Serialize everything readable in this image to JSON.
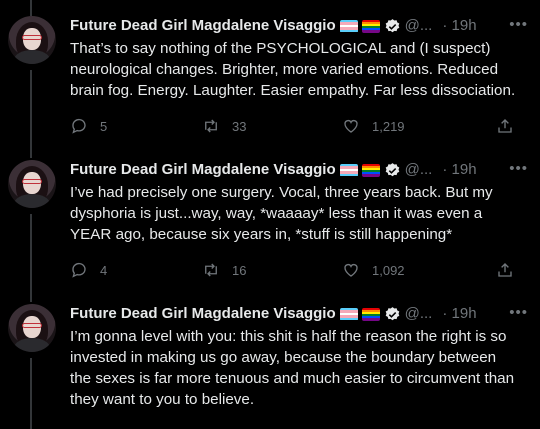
{
  "tweets": [
    {
      "name": "Future Dead Girl Magdalene Visaggio",
      "handle": "@...",
      "time": "· 19h",
      "lines": [
        "That’s to say nothing of the PSYCHOLOGICAL and (I suspect)",
        "neurological changes. Brighter, more varied emotions. Reduced",
        "brain fog. Energy. Laughter. Easier empathy. Far less dissociation."
      ],
      "replies": "5",
      "retweets": "33",
      "likes": "1,219"
    },
    {
      "name": "Future Dead Girl Magdalene Visaggio",
      "handle": "@...",
      "time": "· 19h",
      "lines": [
        "I’ve had precisely one surgery. Vocal, three years back. But my",
        "dysphoria is just...way, way, *waaaay* less than it was even a",
        "YEAR ago, because six years in, *stuff is still happening*"
      ],
      "replies": "4",
      "retweets": "16",
      "likes": "1,092"
    },
    {
      "name": "Future Dead Girl Magdalene Visaggio",
      "handle": "@...",
      "time": "· 19h",
      "lines": [
        "I’m gonna level with you: this shit is half the reason the right is so",
        "invested in making us go away, because the boundary between",
        "the sexes is far more tenuous and much easier to circumvent than",
        "they want to you to believe."
      ]
    }
  ],
  "colors": {
    "background": "#000000",
    "text": "#e7e9ea",
    "muted": "#71767b",
    "thread_line": "#333639"
  },
  "icons": {
    "verified": "verified-badge-icon",
    "trans_flag": "trans-flag-emoji",
    "rainbow_flag": "rainbow-flag-emoji",
    "more": "more-horizontal-icon",
    "reply": "reply-icon",
    "retweet": "retweet-icon",
    "like": "heart-icon",
    "share": "share-icon"
  }
}
